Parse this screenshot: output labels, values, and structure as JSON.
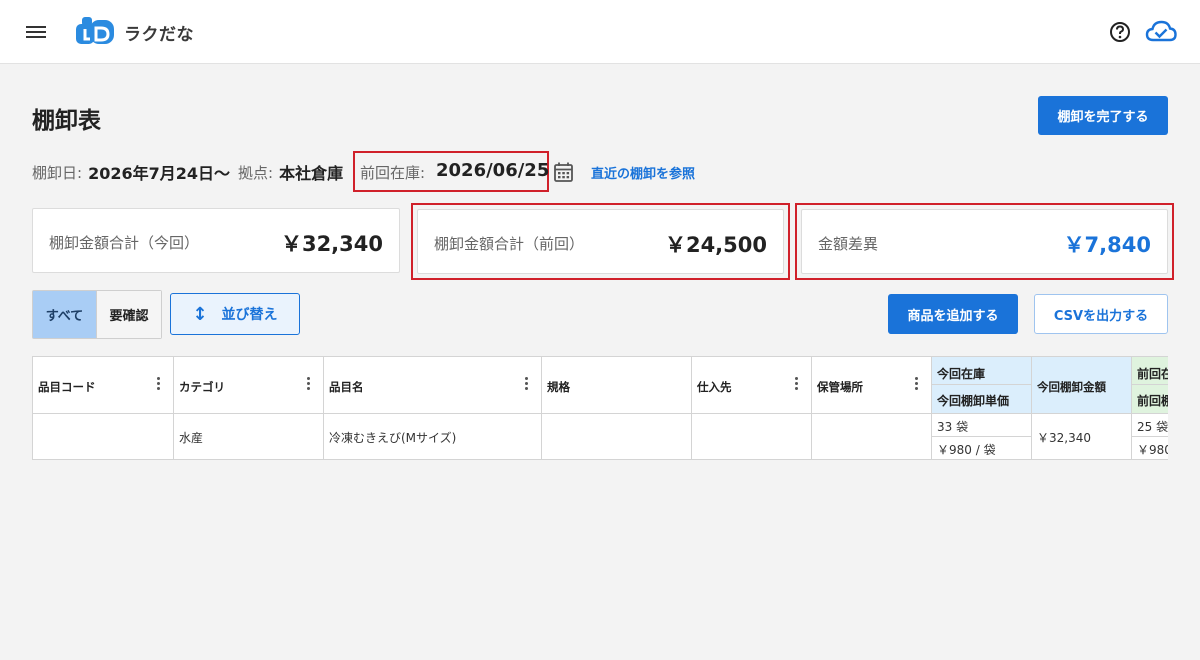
{
  "header": {
    "app_name": "ラクだな",
    "menu_icon": "hamburger-menu-icon",
    "help_icon": "question-circle-icon",
    "sync_icon": "cloud-check-icon",
    "brand_color": "#1a73d9"
  },
  "page": {
    "title": "棚卸表",
    "finish_button": "棚卸を完了する"
  },
  "info": {
    "date_label": "棚卸日:",
    "date_value": "2026年7月24日〜",
    "base_label": "拠点:",
    "base_value": "本社倉庫",
    "prev_label": "前回在庫:",
    "prev_value": "2026/06/25",
    "reference_link": "直近の棚卸を参照"
  },
  "summary": {
    "current_label": "棚卸金額合計（今回）",
    "current_value": "￥32,340",
    "previous_label": "棚卸金額合計（前回）",
    "previous_value": "￥24,500",
    "diff_label": "金額差異",
    "diff_value": "￥7,840"
  },
  "toolbar": {
    "filter_all": "すべて",
    "filter_check": "要確認",
    "sort_button": "並び替え",
    "add_button": "商品を追加する",
    "csv_button": "CSVを出力する"
  },
  "table": {
    "headers": {
      "code": "品目コード",
      "category": "カテゴリ",
      "name": "品目名",
      "spec": "規格",
      "supplier": "仕入先",
      "location": "保管場所",
      "current_stock": "今回在庫",
      "current_unit_price": "今回棚卸単価",
      "current_amount": "今回棚卸金額",
      "prev_stock": "前回在",
      "prev_unit_price": "前回棚"
    },
    "rows": [
      {
        "code": "",
        "category": "水産",
        "name": "冷凍むきえび(Mサイズ)",
        "spec": "",
        "supplier": "",
        "location": "",
        "current_stock": "33 袋",
        "current_unit_price": "￥980 / 袋",
        "current_amount": "￥32,340",
        "prev_stock": "25 袋",
        "prev_unit_price": "￥980"
      }
    ]
  }
}
